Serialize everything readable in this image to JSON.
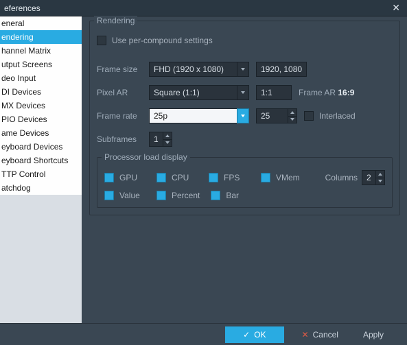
{
  "window": {
    "title": "eferences"
  },
  "sidebar": {
    "items": [
      {
        "label": "eneral"
      },
      {
        "label": "endering"
      },
      {
        "label": "hannel Matrix"
      },
      {
        "label": "utput Screens"
      },
      {
        "label": "deo Input"
      },
      {
        "label": "DI Devices"
      },
      {
        "label": "MX Devices"
      },
      {
        "label": "PIO Devices"
      },
      {
        "label": "ame Devices"
      },
      {
        "label": "eyboard Devices"
      },
      {
        "label": "eyboard Shortcuts"
      },
      {
        "label": "TTP Control"
      },
      {
        "label": "atchdog"
      }
    ],
    "selected_index": 1
  },
  "rendering": {
    "title": "Rendering",
    "use_per_compound_label": "Use per-compound settings",
    "frame_size_label": "Frame size",
    "frame_size_value": "FHD (1920 x 1080)",
    "frame_size_px": "1920, 1080",
    "pixel_ar_label": "Pixel AR",
    "pixel_ar_value": "Square (1:1)",
    "pixel_ar_ratio": "1:1",
    "frame_ar_label": "Frame AR",
    "frame_ar_value": "16:9",
    "frame_rate_label": "Frame rate",
    "frame_rate_value": "25p",
    "frame_rate_num": "25",
    "interlaced_label": "Interlaced",
    "subframes_label": "Subframes",
    "subframes_value": "1"
  },
  "pld": {
    "title": "Processor load display",
    "gpu": "GPU",
    "cpu": "CPU",
    "fps": "FPS",
    "vmem": "VMem",
    "value": "Value",
    "percent": "Percent",
    "bar": "Bar",
    "columns_label": "Columns",
    "columns_value": "2"
  },
  "footer": {
    "ok": "OK",
    "cancel": "Cancel",
    "apply": "Apply"
  }
}
